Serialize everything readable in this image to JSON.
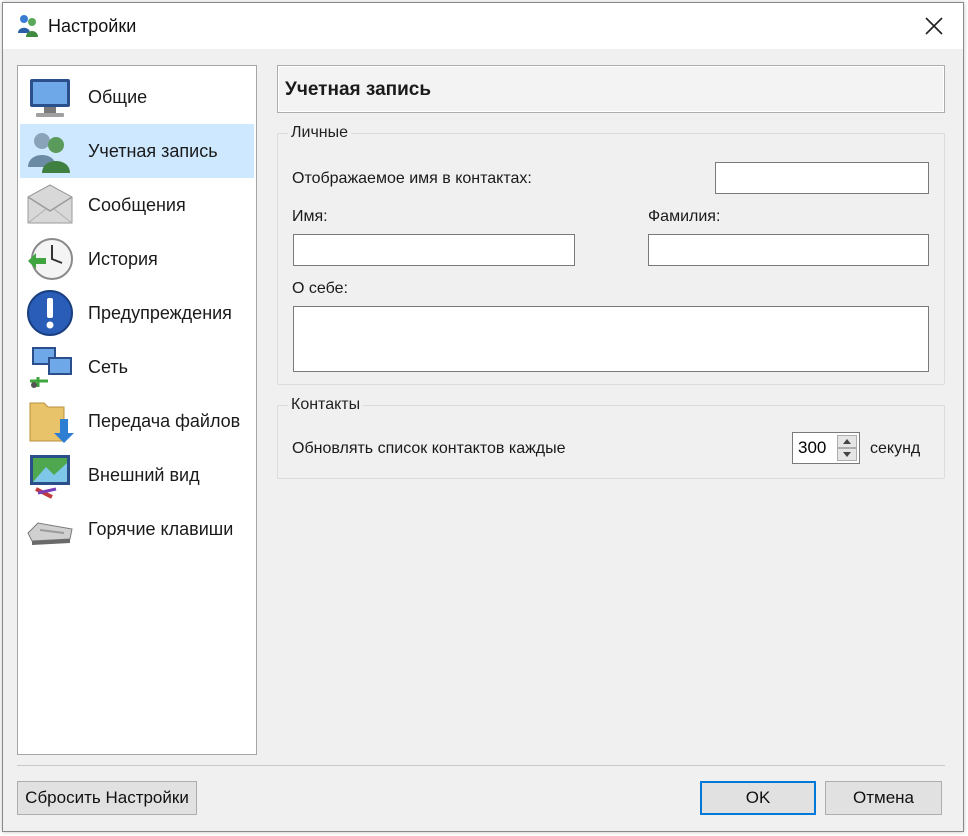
{
  "window": {
    "title": "Настройки",
    "app_icon": "settings-people-icon"
  },
  "sidebar": {
    "items": [
      {
        "label": "Общие",
        "icon": "monitor-icon",
        "selected": false
      },
      {
        "label": "Учетная запись",
        "icon": "users-icon",
        "selected": true
      },
      {
        "label": "Сообщения",
        "icon": "envelope-icon",
        "selected": false
      },
      {
        "label": "История",
        "icon": "clock-icon",
        "selected": false
      },
      {
        "label": "Предупреждения",
        "icon": "alert-icon",
        "selected": false
      },
      {
        "label": "Сеть",
        "icon": "network-icon",
        "selected": false
      },
      {
        "label": "Передача файлов",
        "icon": "folder-transfer-icon",
        "selected": false
      },
      {
        "label": "Внешний вид",
        "icon": "appearance-icon",
        "selected": false
      },
      {
        "label": "Горячие клавиши",
        "icon": "keyboard-icon",
        "selected": false
      }
    ]
  },
  "content": {
    "header": "Учетная запись",
    "personal": {
      "legend": "Личные",
      "display_name_label": "Отображаемое имя в контактах:",
      "display_name_value": "",
      "first_name_label": "Имя:",
      "first_name_value": "",
      "last_name_label": "Фамилия:",
      "last_name_value": "",
      "about_label": "О себе:",
      "about_value": ""
    },
    "contacts": {
      "legend": "Контакты",
      "update_label": "Обновлять список контактов каждые",
      "update_value": "300",
      "unit_label": "секунд"
    }
  },
  "footer": {
    "reset_label": "Сбросить Настройки",
    "ok_label": "OK",
    "cancel_label": "Отмена"
  },
  "colors": {
    "selection": "#cde8ff",
    "focus_border": "#0078d7",
    "dialog_bg": "#f0f0f0"
  }
}
